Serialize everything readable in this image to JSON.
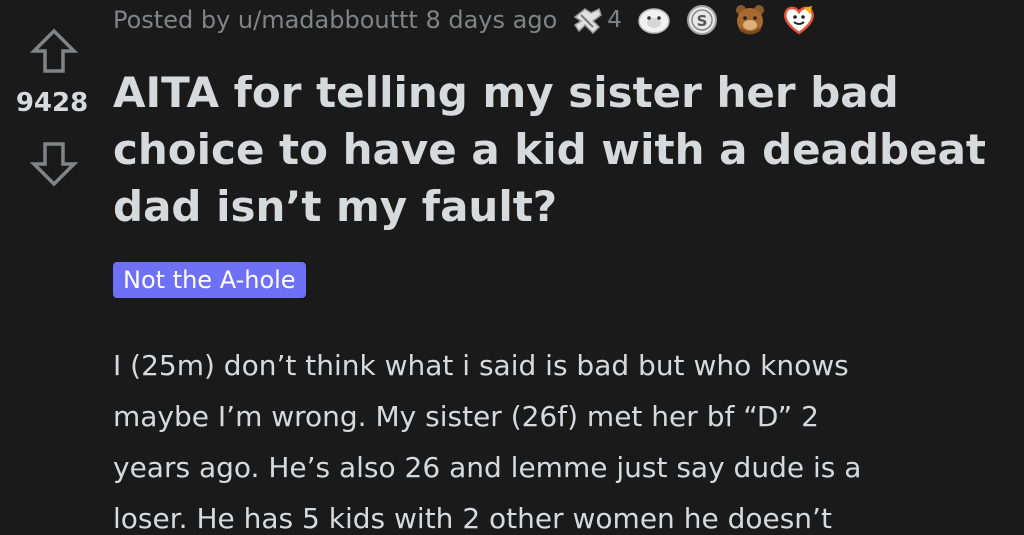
{
  "post": {
    "score": "9428",
    "meta": {
      "posted_by": "Posted by u/madabbouttt 8 days ago",
      "awards": [
        {
          "name": "wholesome-seal-award",
          "count": "4"
        },
        {
          "name": "hugz-award",
          "count": ""
        },
        {
          "name": "silver-award",
          "count": ""
        },
        {
          "name": "bear-hug-award",
          "count": ""
        },
        {
          "name": "wholesome-heart-award",
          "count": ""
        }
      ]
    },
    "title": "AITA for telling my sister her bad choice to have a kid with a deadbeat dad isn’t my fault?",
    "flair": "Not the A-hole",
    "flair_color": "#6e71f5",
    "body_lines": [
      "I (25m) don’t think what i said is bad but who knows",
      "maybe I’m wrong. My sister (26f) met her bf “D” 2",
      "years ago. He’s also 26 and lemme just say dude is a",
      "loser. He has 5 kids with 2 other women he doesn’t"
    ]
  },
  "icons": {
    "upvote": "upvote-arrow-icon",
    "downvote": "downvote-arrow-icon"
  },
  "colors": {
    "background": "#1a1a1b",
    "text": "#d7dadc",
    "meta": "#818384"
  }
}
